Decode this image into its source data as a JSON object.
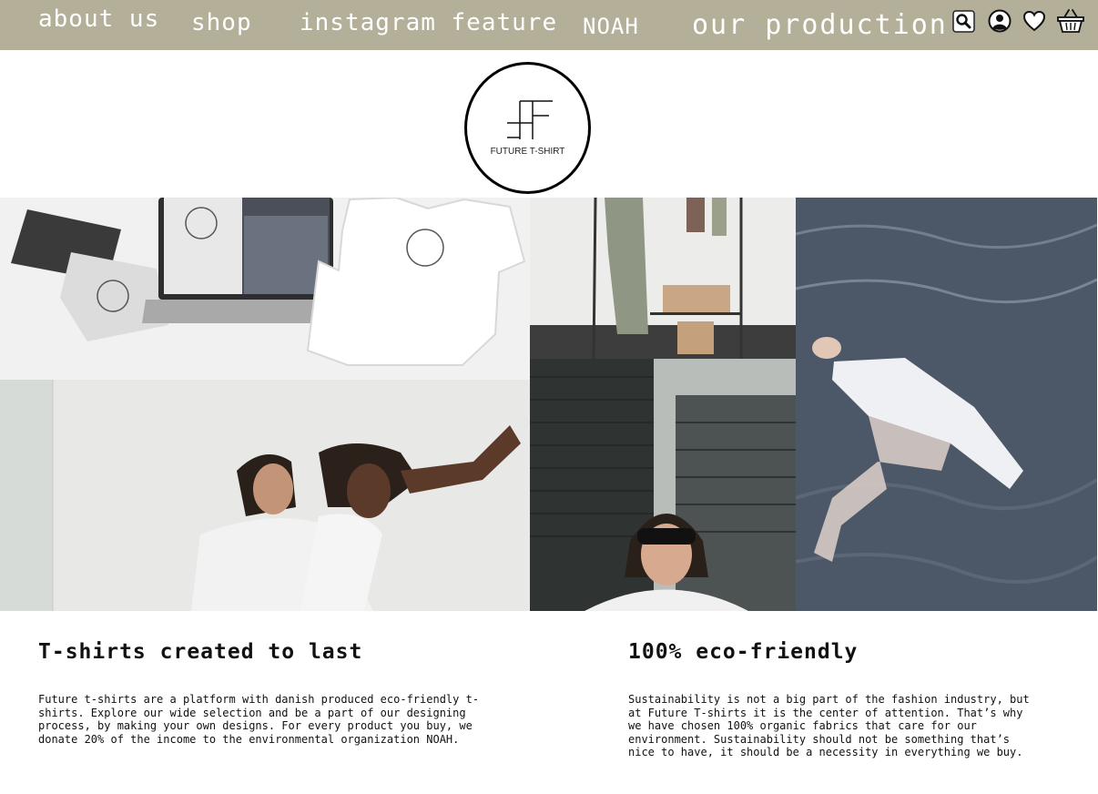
{
  "nav": {
    "links": [
      "about us",
      "shop",
      "instagram feature",
      "NOAH",
      "our production"
    ],
    "icons": [
      "search-icon",
      "account-icon",
      "heart-icon",
      "basket-icon"
    ],
    "background": "#b3af98"
  },
  "logo": {
    "brand": "FUTURE T-SHIRT"
  },
  "sections": [
    {
      "title": "T-shirts created to last",
      "body": "Future t-shirts are a platform with danish produced eco-friendly t-\nshirts. Explore our wide selection and be a part of our designing\nprocess, by making your own designs. For every product you buy, we\ndonate 20% of the income to the environmental organization NOAH."
    },
    {
      "title": "100% eco-friendly",
      "body": "Sustainability is not a big part of the fashion industry, but\nat Future T-shirts it is the center of attention. That’s why\nwe have chosen 100% organic fabrics that care for our\nenvironment.  Sustainability should not be something that’s\nnice to have, it should be a necessity in everything we buy."
    }
  ]
}
